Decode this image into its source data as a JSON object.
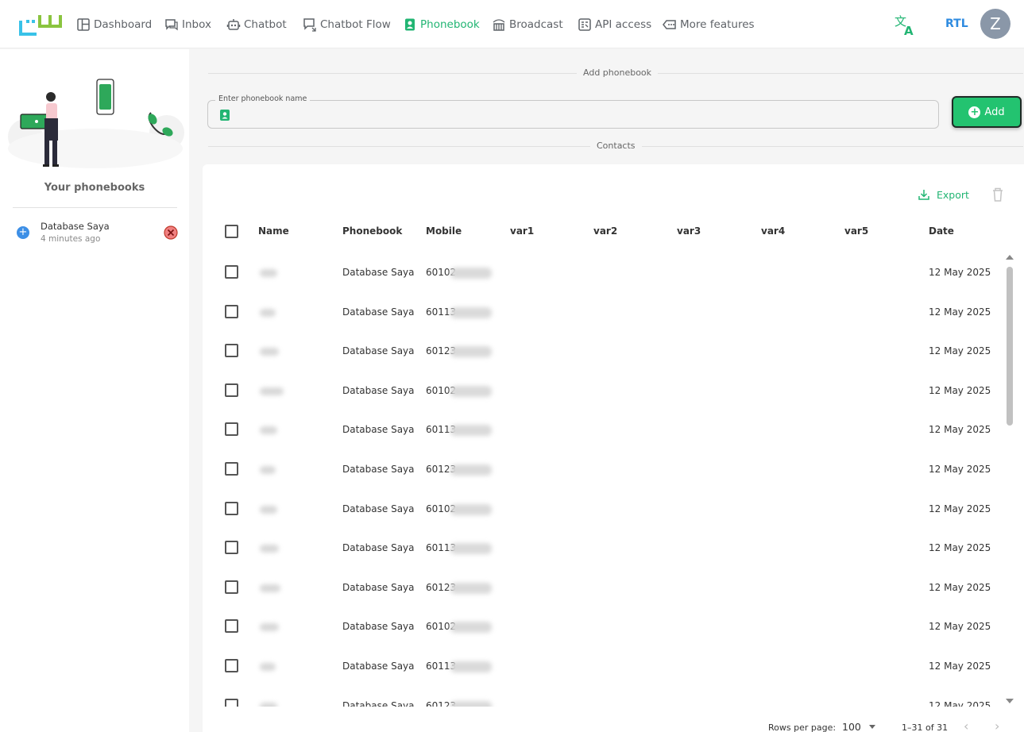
{
  "nav": {
    "items": [
      {
        "label": "Dashboard",
        "icon": "dashboard-icon"
      },
      {
        "label": "Inbox",
        "icon": "inbox-icon"
      },
      {
        "label": "Chatbot",
        "icon": "chatbot-icon"
      },
      {
        "label": "Chatbot Flow",
        "icon": "chatbot-flow-icon"
      },
      {
        "label": "Phonebook",
        "icon": "phonebook-icon",
        "active": true
      },
      {
        "label": "Broadcast",
        "icon": "broadcast-icon"
      },
      {
        "label": "API access",
        "icon": "api-icon"
      },
      {
        "label": "More features",
        "icon": "more-icon"
      }
    ],
    "rtl_label": "RTL",
    "avatar_letter": "Z",
    "active_color": "#22b573"
  },
  "sidebar": {
    "title": "Your phonebooks",
    "phonebooks": [
      {
        "name": "Database Saya",
        "time": "4 minutes ago"
      }
    ]
  },
  "add_phonebook": {
    "section_label": "Add phonebook",
    "field_label": "Enter phonebook name",
    "value": "",
    "add_label": "Add"
  },
  "contacts": {
    "section_label": "Contacts",
    "export_label": "Export",
    "columns": [
      "Name",
      "Phonebook",
      "Mobile",
      "var1",
      "var2",
      "var3",
      "var4",
      "var5",
      "Date"
    ],
    "rows": [
      {
        "phonebook": "Database Saya",
        "mobile_prefix": "60102",
        "date": "12 May 2025"
      },
      {
        "phonebook": "Database Saya",
        "mobile_prefix": "60113",
        "date": "12 May 2025"
      },
      {
        "phonebook": "Database Saya",
        "mobile_prefix": "60123",
        "date": "12 May 2025"
      },
      {
        "phonebook": "Database Saya",
        "mobile_prefix": "60102",
        "date": "12 May 2025"
      },
      {
        "phonebook": "Database Saya",
        "mobile_prefix": "60113",
        "date": "12 May 2025"
      },
      {
        "phonebook": "Database Saya",
        "mobile_prefix": "60123",
        "date": "12 May 2025"
      },
      {
        "phonebook": "Database Saya",
        "mobile_prefix": "60102",
        "date": "12 May 2025"
      },
      {
        "phonebook": "Database Saya",
        "mobile_prefix": "60113",
        "date": "12 May 2025"
      },
      {
        "phonebook": "Database Saya",
        "mobile_prefix": "60123",
        "date": "12 May 2025"
      },
      {
        "phonebook": "Database Saya",
        "mobile_prefix": "60102",
        "date": "12 May 2025"
      },
      {
        "phonebook": "Database Saya",
        "mobile_prefix": "60113",
        "date": "12 May 2025"
      },
      {
        "phonebook": "Database Saya",
        "mobile_prefix": "60123",
        "date": "12 May 2025"
      }
    ],
    "footer": {
      "rows_per_page_label": "Rows per page:",
      "rows_per_page": "100",
      "range": "1–31 of 31"
    }
  }
}
